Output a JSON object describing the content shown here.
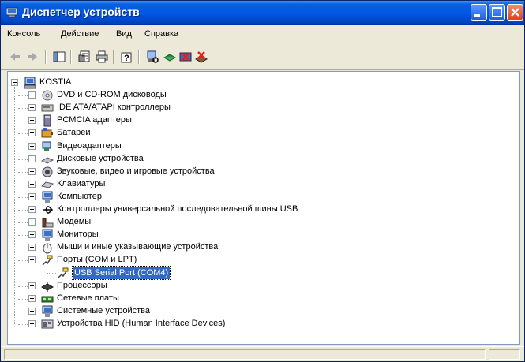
{
  "window": {
    "title": "Диспетчер устройств",
    "title_color": "#0058e6"
  },
  "menu": [
    "Консоль",
    "Действие",
    "Вид",
    "Справка"
  ],
  "toolbar_icons": [
    "back-arrow-icon",
    "forward-arrow-icon",
    "console-tree-icon",
    "properties-icon",
    "print-icon",
    "help-icon",
    "scan-hardware-icon",
    "update-driver-icon",
    "disable-device-icon",
    "uninstall-device-icon"
  ],
  "tree": {
    "root": "KOSTIA",
    "items": [
      {
        "label": "DVD и CD-ROM дисководы",
        "icon": "dvd-drive-icon"
      },
      {
        "label": "IDE ATA/ATAPI контроллеры",
        "icon": "ide-controller-icon"
      },
      {
        "label": "PCMCIA адаптеры",
        "icon": "pcmcia-adapter-icon"
      },
      {
        "label": "Батареи",
        "icon": "battery-icon"
      },
      {
        "label": "Видеоадаптеры",
        "icon": "display-adapter-icon"
      },
      {
        "label": "Дисковые устройства",
        "icon": "disk-drive-icon"
      },
      {
        "label": "Звуковые, видео и игровые устройства",
        "icon": "sound-device-icon"
      },
      {
        "label": "Клавиатуры",
        "icon": "keyboard-icon"
      },
      {
        "label": "Компьютер",
        "icon": "computer-icon"
      },
      {
        "label": "Контроллеры универсальной последовательной шины USB",
        "icon": "usb-icon"
      },
      {
        "label": "Модемы",
        "icon": "modem-icon"
      },
      {
        "label": "Мониторы",
        "icon": "monitor-icon"
      },
      {
        "label": "Мыши и иные указывающие устройства",
        "icon": "mouse-icon"
      },
      {
        "label": "Порты (COM и LPT)",
        "icon": "port-icon",
        "expanded": true,
        "children": [
          {
            "label": "USB Serial Port (COM4)",
            "icon": "port-icon",
            "selected": true
          }
        ]
      },
      {
        "label": "Процессоры",
        "icon": "processor-icon"
      },
      {
        "label": "Сетевые платы",
        "icon": "network-card-icon"
      },
      {
        "label": "Системные устройства",
        "icon": "system-device-icon"
      },
      {
        "label": "Устройства HID (Human Interface Devices)",
        "icon": "hid-icon"
      }
    ]
  },
  "colors": {
    "selection": "#316ac5",
    "titlebar": "#0058e6"
  }
}
